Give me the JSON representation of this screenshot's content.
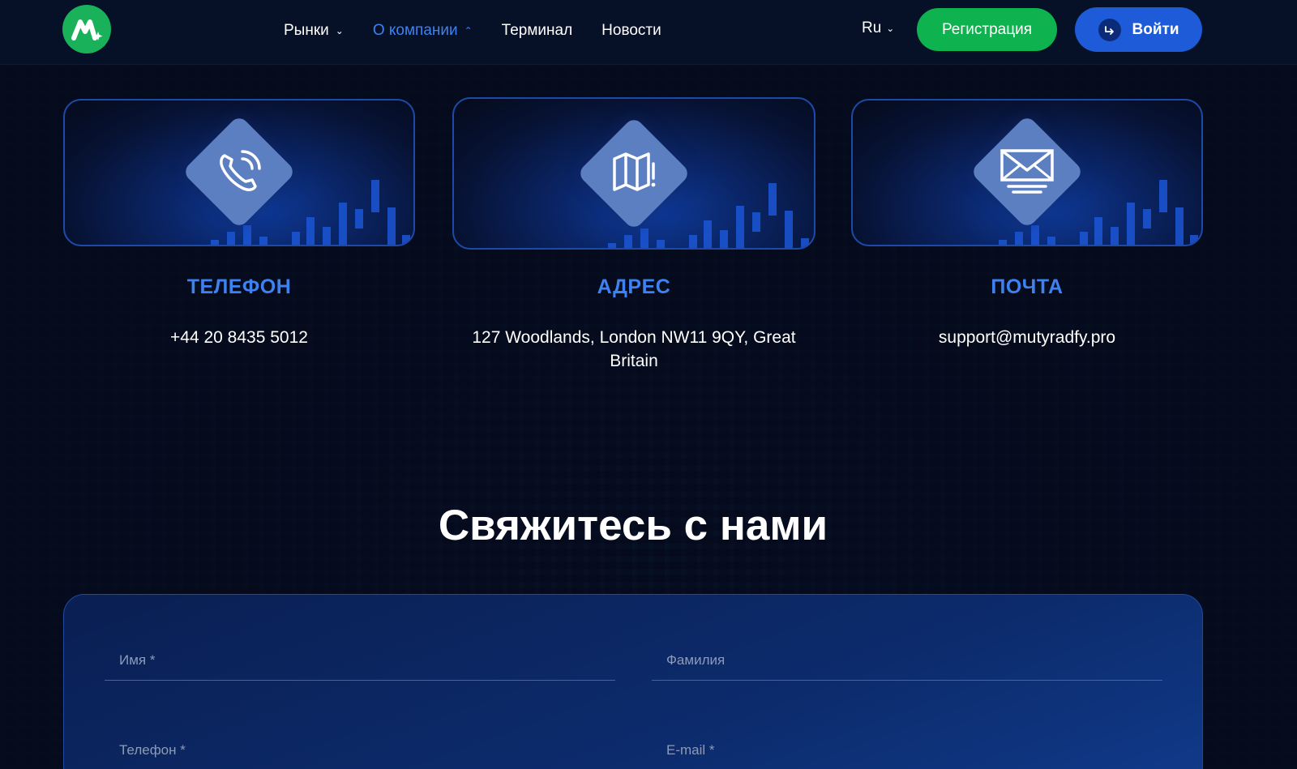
{
  "header": {
    "logo_icon": "brand-logo-icon",
    "nav": [
      {
        "label": "Рынки",
        "has_dropdown": true,
        "active": false
      },
      {
        "label": "О компании",
        "has_dropdown": true,
        "active": true
      },
      {
        "label": "Терминал",
        "has_dropdown": false,
        "active": false
      },
      {
        "label": "Новости",
        "has_dropdown": false,
        "active": false
      }
    ],
    "language": "Ru",
    "register_label": "Регистрация",
    "login_label": "Войти"
  },
  "contacts": [
    {
      "icon": "phone-icon",
      "title": "ТЕЛЕФОН",
      "value": "+44 20 8435 5012"
    },
    {
      "icon": "map-icon",
      "title": "АДРЕС",
      "value": "127 Woodlands, London NW11 9QY, Great Britain"
    },
    {
      "icon": "mail-icon",
      "title": "ПОЧТА",
      "value": "support@mutyradfy.pro"
    }
  ],
  "contact_form": {
    "title": "Свяжитесь с нами",
    "first_name_placeholder": "Имя *",
    "last_name_placeholder": "Фамилия",
    "phone_placeholder": "Телефон *",
    "email_placeholder": "E-mail *"
  },
  "colors": {
    "accent_blue": "#3d82f0",
    "register_green": "#0eb24e",
    "login_blue": "#1e5bd8",
    "background": "#050b1c"
  }
}
